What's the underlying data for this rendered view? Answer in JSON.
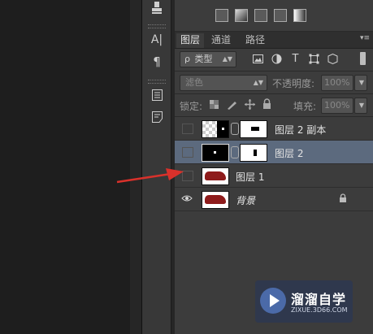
{
  "toolstrip": {
    "icons": [
      "stamp-icon",
      "character-icon",
      "paragraph-icon",
      "notes-icon",
      "list-icon"
    ],
    "char_glyph": "A|",
    "para_glyph": "¶"
  },
  "panel": {
    "tabs": [
      {
        "label": "图层",
        "active": true
      },
      {
        "label": "通道",
        "active": false
      },
      {
        "label": "路径",
        "active": false
      }
    ],
    "filter": {
      "prefix": "ρ",
      "label": "类型"
    },
    "filter_icons": {
      "t_glyph": "T"
    },
    "blend_mode": "滤色",
    "opacity_label": "不透明度:",
    "opacity_value": "100%",
    "lock_label": "锁定:",
    "fill_label": "填充:",
    "fill_value": "100%",
    "layers": [
      {
        "name": "图层 2 副本",
        "visible": false,
        "selected": false
      },
      {
        "name": "图层 2",
        "visible": false,
        "selected": true
      },
      {
        "name": "图层 1",
        "visible": false,
        "selected": false
      },
      {
        "name": "背景",
        "visible": true,
        "selected": false,
        "locked": true
      }
    ]
  },
  "watermark": {
    "title": "溜溜自学",
    "url": "ZIXUE.3D66.COM"
  },
  "colors": {
    "accent_arrow": "#d9312b",
    "selected_row": "#5c6a7e",
    "panel_bg": "#3c3c3c"
  }
}
